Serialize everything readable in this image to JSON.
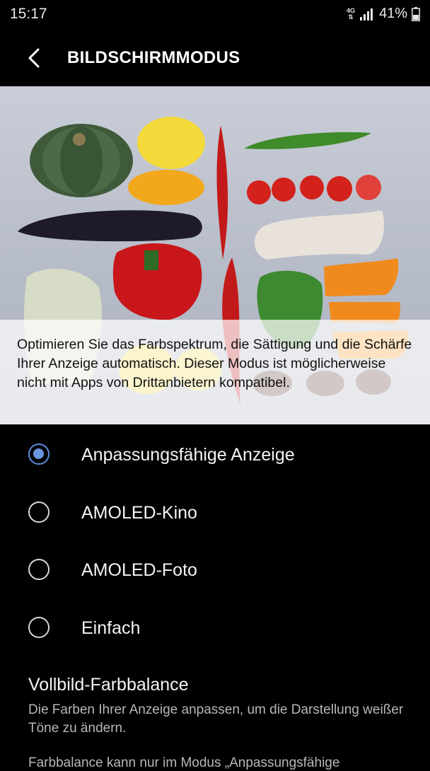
{
  "status_bar": {
    "time": "15:17",
    "network": "4G",
    "battery": "41%"
  },
  "header": {
    "title": "BILDSCHIRMMODUS"
  },
  "preview": {
    "description": "Optimieren Sie das Farbspektrum, die Sättigung und die Schärfe Ihrer Anzeige automatisch. Dieser Modus ist möglicherweise nicht mit Apps von Drittanbietern kompatibel."
  },
  "modes": [
    {
      "label": "Anpassungsfähige Anzeige",
      "selected": true
    },
    {
      "label": "AMOLED-Kino",
      "selected": false
    },
    {
      "label": "AMOLED-Foto",
      "selected": false
    },
    {
      "label": "Einfach",
      "selected": false
    }
  ],
  "color_balance": {
    "title": "Vollbild-Farbbalance",
    "subtitle": "Die Farben Ihrer Anzeige anpassen, um die Darstellung weißer Töne zu ändern.",
    "note": "Farbbalance kann nur im Modus „Anpassungsfähige"
  },
  "colors": {
    "accent": "#6b95dc",
    "background": "#000000"
  }
}
